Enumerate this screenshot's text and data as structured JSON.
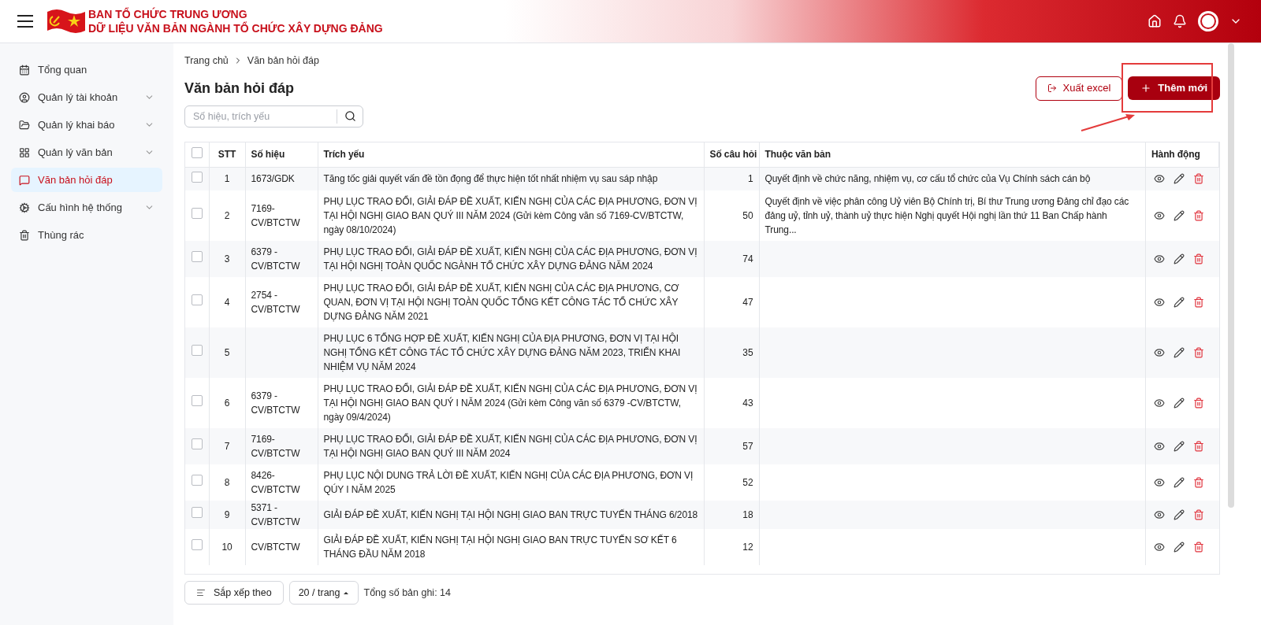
{
  "header": {
    "title_line1": "BAN TỔ CHỨC TRUNG ƯƠNG",
    "title_line2": "DỮ LIỆU VĂN BẢN NGÀNH TỔ CHỨC XÂY DỰNG ĐẢNG"
  },
  "sidebar": {
    "items": [
      {
        "label": "Tổng quan",
        "selected": false,
        "expandable": false
      },
      {
        "label": "Quản lý tài khoản",
        "selected": false,
        "expandable": true
      },
      {
        "label": "Quản lý khai báo",
        "selected": false,
        "expandable": true
      },
      {
        "label": "Quản lý văn bản",
        "selected": false,
        "expandable": true
      },
      {
        "label": "Văn bản hỏi đáp",
        "selected": true,
        "expandable": false
      },
      {
        "label": "Cấu hình hệ thống",
        "selected": false,
        "expandable": true
      },
      {
        "label": "Thùng rác",
        "selected": false,
        "expandable": false
      }
    ]
  },
  "breadcrumb": [
    "Trang chủ",
    "Văn bản hỏi đáp"
  ],
  "page_title": "Văn bản hỏi đáp",
  "buttons": {
    "export": "Xuất excel",
    "add": "Thêm mới"
  },
  "search": {
    "placeholder": "Số hiệu, trích yếu"
  },
  "table": {
    "select_all": {
      "checked": false
    },
    "columns": [
      "STT",
      "Số hiệu",
      "Trích yếu",
      "Số câu hỏi",
      "Thuộc văn bản",
      "Hành động"
    ],
    "rows": [
      {
        "checked": false,
        "stt": "1",
        "so_hieu": "1673/GDK",
        "trich_yeu": "Tăng tốc giải quyết vấn đề tồn đọng để thực hiện tốt nhất nhiệm vụ sau sáp nhập",
        "so_cau_hoi": "1",
        "thuoc_van_ban": "Quyết định về chức năng, nhiệm vụ, cơ cấu tổ chức của Vụ Chính sách cán bộ"
      },
      {
        "checked": false,
        "stt": "2",
        "so_hieu": "7169-CV/BTCTW",
        "trich_yeu": "PHỤ LỤC TRAO ĐỔI, GIẢI ĐÁP ĐỀ XUẤT, KIẾN NGHỊ CỦA CÁC ĐỊA PHƯƠNG, ĐƠN VỊ TẠI HỘI NGHỊ GIAO BAN QUÝ III NĂM 2024 (Gửi kèm Công văn số 7169-CV/BTCTW, ngày 08/10/2024)",
        "so_cau_hoi": "50",
        "thuoc_van_ban": "Quyết định về việc phân công Uỷ viên Bộ Chính trị, Bí thư Trung ương Đảng chỉ đạo các đảng uỷ, tỉnh uỷ, thành uỷ thực hiện Nghị quyết Hội nghị lần thứ 11 Ban Chấp hành Trung..."
      },
      {
        "checked": false,
        "stt": "3",
        "so_hieu": "6379 - CV/BTCTW",
        "trich_yeu": "PHỤ LỤC TRAO ĐỔI, GIẢI ĐÁP ĐỀ XUẤT, KIẾN NGHỊ CỦA CÁC ĐỊA PHƯƠNG, ĐƠN VỊ TẠI HỘI NGHỊ TOÀN QUỐC NGÀNH TỔ CHỨC XÂY DỰNG ĐẢNG NĂM 2024",
        "so_cau_hoi": "74"
      },
      {
        "checked": false,
        "stt": "4",
        "so_hieu": "2754 - CV/BTCTW",
        "trich_yeu": "PHỤ LỤC TRAO ĐỔI, GIẢI ĐÁP ĐỀ XUẤT, KIẾN NGHỊ CỦA CÁC ĐỊA PHƯƠNG, CƠ QUAN, ĐƠN VỊ TẠI HỘI NGHỊ TOÀN QUỐC TỔNG KẾT CÔNG TÁC TỔ CHỨC XÂY DỰNG ĐẢNG NĂM 2021",
        "so_cau_hoi": "47"
      },
      {
        "checked": false,
        "stt": "5",
        "trich_yeu": "PHỤ LỤC 6 TỔNG HỢP ĐỀ XUẤT, KIẾN NGHỊ CỦA ĐỊA PHƯƠNG, ĐƠN VỊ TẠI HỘI NGHỊ TỔNG KẾT CÔNG TÁC TỔ CHỨC XÂY DỰNG ĐẢNG NĂM 2023, TRIỂN KHAI NHIỆM VỤ NĂM 2024",
        "so_cau_hoi": "35"
      },
      {
        "checked": false,
        "stt": "6",
        "so_hieu": "6379 - CV/BTCTW",
        "trich_yeu": "PHỤ LỤC TRAO ĐỔI, GIẢI ĐÁP ĐỀ XUẤT, KIẾN NGHỊ CỦA CÁC ĐỊA PHƯƠNG, ĐƠN VỊ TẠI HỘI NGHỊ GIAO BAN QUÝ I NĂM 2024 (Gửi kèm Công văn số 6379 -CV/BTCTW, ngày 09/4/2024)",
        "so_cau_hoi": "43"
      },
      {
        "checked": false,
        "stt": "7",
        "so_hieu": "7169-CV/BTCTW",
        "trich_yeu": "PHỤ LỤC TRAO ĐỔI, GIẢI ĐÁP ĐỀ XUẤT, KIẾN NGHỊ CỦA CÁC ĐỊA PHƯƠNG, ĐƠN VỊ TẠI HỘI NGHỊ GIAO BAN QUÝ III NĂM 2024",
        "so_cau_hoi": "57"
      },
      {
        "checked": false,
        "stt": "8",
        "so_hieu": "8426-CV/BTCTW",
        "trich_yeu": "PHỤ LỤC NỘI DUNG TRẢ LỜI ĐỀ XUẤT, KIẾN NGHỊ CỦA CÁC ĐỊA PHƯƠNG, ĐƠN VỊ QÚY I NĂM 2025",
        "so_cau_hoi": "52"
      },
      {
        "checked": false,
        "stt": "9",
        "so_hieu": "5371 - CV/BTCTW",
        "trich_yeu": "GIẢI ĐÁP ĐỀ XUẤT, KIẾN NGHỊ TẠI HỘI NGHỊ GIAO BAN TRỰC TUYẾN THÁNG 6/2018",
        "so_cau_hoi": "18"
      },
      {
        "checked": false,
        "stt": "10",
        "so_hieu": "CV/BTCTW",
        "trich_yeu": "GIẢI ĐÁP ĐỀ XUẤT, KIẾN NGHỊ TẠI HỘI NGHỊ GIAO BAN TRỰC TUYẾN SƠ KẾT 6 THÁNG ĐẦU NĂM 2018",
        "so_cau_hoi": "12"
      }
    ]
  },
  "footer": {
    "sort": "Sắp xếp theo",
    "page_size": "20 / trang",
    "total": "Tổng số bản ghi: 14"
  }
}
